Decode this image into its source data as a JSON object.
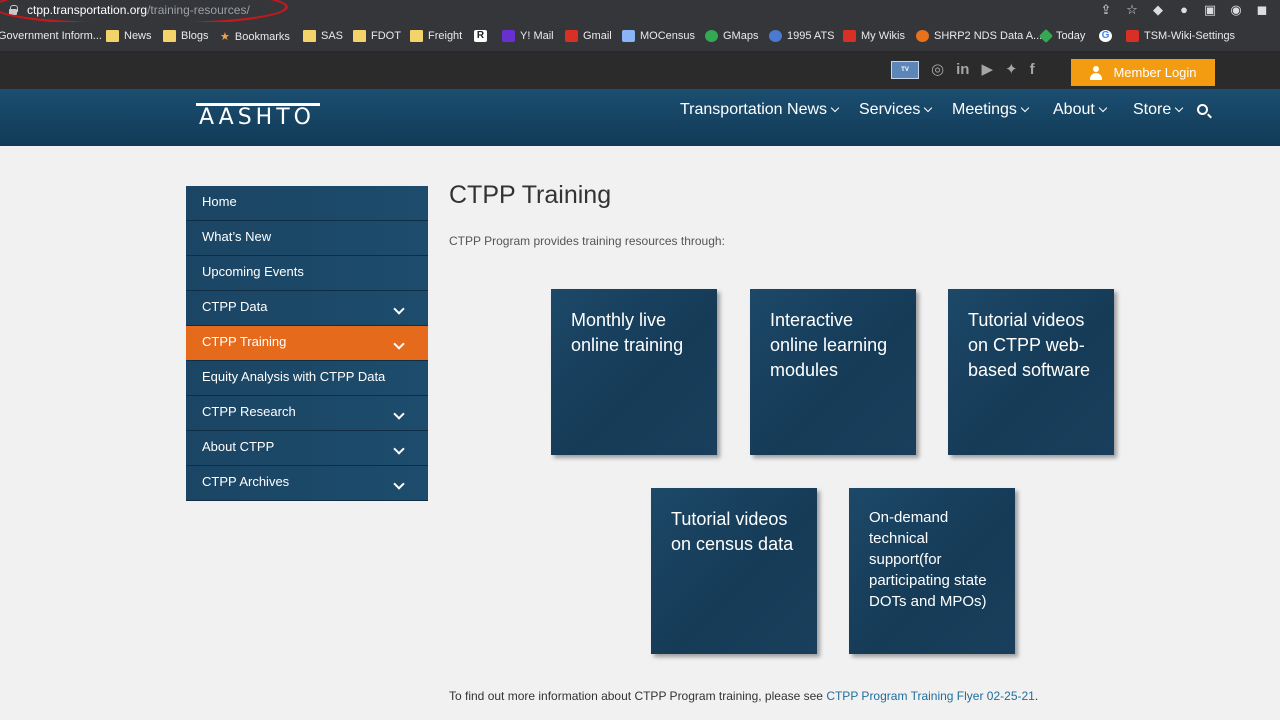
{
  "browser": {
    "url_host": "ctpp.transportation.org",
    "url_path": "/training-resources/",
    "bookmarks": [
      "Government Inform...",
      "News",
      "Blogs",
      "Bookmarks",
      "SAS",
      "FDOT",
      "Freight",
      "R",
      "Y! Mail",
      "Gmail",
      "MOCensus",
      "GMaps",
      "1995 ATS",
      "My Wikis",
      "SHRP2 NDS Data A...",
      "Today",
      "G",
      "TSM-Wiki-Settings"
    ]
  },
  "utility": {
    "member_login": "Member Login",
    "tv_label": "TV",
    "social": [
      "instagram-icon",
      "linkedin-icon",
      "youtube-icon",
      "twitter-icon",
      "facebook-icon"
    ]
  },
  "nav": {
    "logo": "AASHTO",
    "items": [
      {
        "label": "Transportation News"
      },
      {
        "label": "Services"
      },
      {
        "label": "Meetings"
      },
      {
        "label": "About"
      },
      {
        "label": "Store"
      }
    ]
  },
  "sidebar": {
    "items": [
      {
        "label": "Home",
        "has_children": false,
        "active": false
      },
      {
        "label": "What’s New",
        "has_children": false,
        "active": false
      },
      {
        "label": "Upcoming Events",
        "has_children": false,
        "active": false
      },
      {
        "label": "CTPP Data",
        "has_children": true,
        "active": false
      },
      {
        "label": "CTPP Training",
        "has_children": true,
        "active": true
      },
      {
        "label": "Equity Analysis with CTPP Data",
        "has_children": false,
        "active": false
      },
      {
        "label": "CTPP Research",
        "has_children": true,
        "active": false
      },
      {
        "label": "About CTPP",
        "has_children": true,
        "active": false
      },
      {
        "label": "CTPP Archives",
        "has_children": true,
        "active": false
      }
    ]
  },
  "content": {
    "title": "CTPP Training",
    "intro": "CTPP Program provides training resources through:",
    "tiles": [
      {
        "label": "Monthly live online training"
      },
      {
        "label": "Interactive online learning modules"
      },
      {
        "label": "Tutorial videos on CTPP web-based software"
      },
      {
        "label": "Tutorial videos on census data"
      },
      {
        "label": "On-demand technical support(for participating state DOTs and MPOs)"
      }
    ],
    "footer_text": "To find out more information about CTPP Program training, please see ",
    "footer_link": "CTPP Program Training Flyer 02-25-21",
    "footer_end": "."
  },
  "colors": {
    "nav_bg": "#1b4e70",
    "active_orange": "#e56a1c",
    "member_orange": "#f39c12",
    "link_blue": "#1f6e9c"
  }
}
